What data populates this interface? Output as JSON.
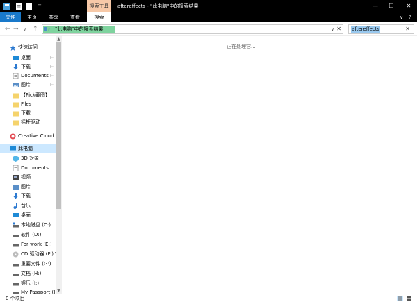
{
  "window": {
    "context_tab": "搜索工具",
    "title": "aftereffects - \"此电脑\"中的搜索结果",
    "minimize": "—",
    "maximize": "☐",
    "close": "✕"
  },
  "ribbon": {
    "tabs": [
      "文件",
      "主页",
      "共享",
      "查看",
      "搜索"
    ],
    "collapse": "∨",
    "help": "?"
  },
  "address": {
    "back": "←",
    "forward": "→",
    "recent": "∨",
    "up": "↑",
    "chevron": "›",
    "path": "\"此电脑\"中的搜索结果",
    "dropdown": "∨",
    "close": "✕"
  },
  "search": {
    "query": "aftereffects",
    "close": "✕"
  },
  "nav": {
    "quick_access": "快速访问",
    "pinned": [
      "桌面",
      "下载",
      "Documents",
      "图片"
    ],
    "folders": [
      "【Pick截图】",
      "Files",
      "下载",
      "摇杆驱动"
    ],
    "creative_cloud": "Creative Cloud F",
    "this_pc": "此电脑",
    "pc_items": [
      "3D 对象",
      "Documents",
      "视频",
      "图片",
      "下载",
      "音乐",
      "桌面"
    ],
    "drives": [
      "本地磁盘 (C:)",
      "软件 (D:)",
      "For work (E:)",
      "CD 驱动器 (F:) \\",
      "重要文件 (G:)",
      "文档 (H:)",
      "娱乐 (I:)",
      "My Passport (J"
    ],
    "pin_glyph": "⊢",
    "scroll_up": "▲",
    "scroll_down": "▼"
  },
  "content": {
    "status": "正在处理它..."
  },
  "statusbar": {
    "items": "0 个项目"
  },
  "colors": {
    "file_tab": "#1979ca",
    "context_tab": "#f7c9a8",
    "address_highlight": "#7ed39e",
    "selection": "#cce8ff"
  }
}
